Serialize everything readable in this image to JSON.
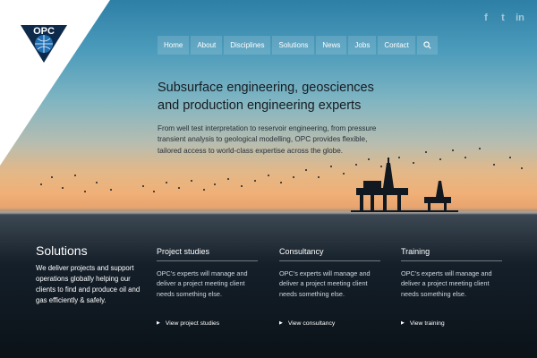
{
  "brand": {
    "logo_text": "OPC"
  },
  "social": [
    {
      "icon": "facebook-icon",
      "glyph": "f"
    },
    {
      "icon": "twitter-icon",
      "glyph": "t"
    },
    {
      "icon": "linkedin-icon",
      "glyph": "in"
    }
  ],
  "nav": {
    "items": [
      {
        "label": "Home"
      },
      {
        "label": "About"
      },
      {
        "label": "Disciplines"
      },
      {
        "label": "Solutions"
      },
      {
        "label": "News"
      },
      {
        "label": "Jobs"
      },
      {
        "label": "Contact"
      }
    ],
    "search_icon": "search-icon"
  },
  "hero": {
    "heading_line1": "Subsurface engineering, geosciences",
    "heading_line2": "and production engineering experts",
    "paragraph": "From well test interpretation to reservoir engineering, from pressure transient analysis to geological modelling, OPC provides flexible, tailored access to world-class expertise across the globe."
  },
  "solutions": {
    "title": "Solutions",
    "text": "We deliver projects and support operations globally helping our clients to find and produce oil and gas efficiently & safely."
  },
  "columns": [
    {
      "title": "Project studies",
      "text": "OPC's experts will manage and deliver a project meeting client needs something else.",
      "link": "View project studies"
    },
    {
      "title": "Consultancy",
      "text": "OPC's experts will manage and deliver a project meeting client needs something else.",
      "link": "View consultancy"
    },
    {
      "title": "Training",
      "text": "OPC's experts will manage and deliver a project meeting client needs something else.",
      "link": "View training"
    }
  ],
  "colors": {
    "corner": "#ffffff",
    "logo_navy": "#0d2a4a",
    "logo_blue": "#1f6fb2"
  }
}
